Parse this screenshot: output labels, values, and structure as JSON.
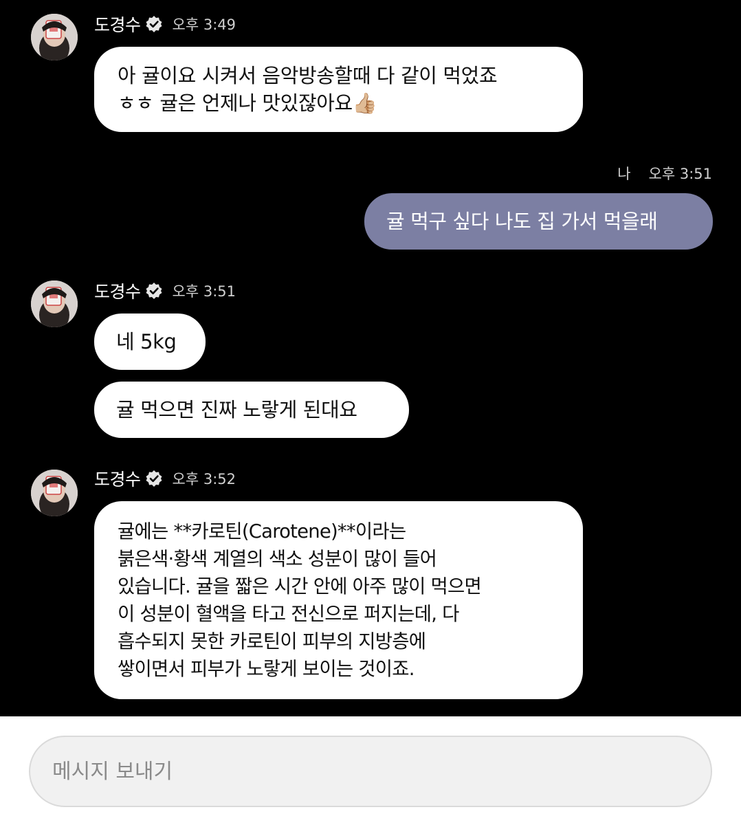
{
  "sender_name": "도경수",
  "me_label": "나",
  "messages": [
    {
      "sender": "도경수",
      "time": "오후 3:49",
      "bubbles": [
        "아 귤이요 시켜서 음악방송할때 다 같이 먹었죠\nㅎㅎ 귤은 언제나 맛있잖아요👍🏼"
      ]
    },
    {
      "sender": "나",
      "time": "오후 3:51",
      "bubbles": [
        "귤 먹구 싶다 나도 집 가서 먹을래"
      ]
    },
    {
      "sender": "도경수",
      "time": "오후 3:51",
      "bubbles": [
        "네 5kg",
        "귤 먹으면 진짜 노랗게 된대요"
      ]
    },
    {
      "sender": "도경수",
      "time": "오후 3:52",
      "bubbles": [
        "귤에는 **카로틴(Carotene)**이라는\n붉은색·황색 계열의 색소 성분이 많이 들어\n있습니다. 귤을 짧은 시간 안에 아주 많이 먹으면\n이 성분이 혈액을 타고 전신으로 퍼지는데, 다\n흡수되지 못한 카로틴이 피부의 지방층에\n쌓이면서 피부가 노랗게 보이는 것이죠."
      ]
    }
  ],
  "composer": {
    "placeholder": "메시지 보내기"
  },
  "icons": {
    "verified": "verified-badge-icon",
    "avatar": "profile-photo"
  },
  "colors": {
    "background": "#000000",
    "incoming_bubble": "#ffffff",
    "outgoing_bubble": "#7c7fa3"
  }
}
